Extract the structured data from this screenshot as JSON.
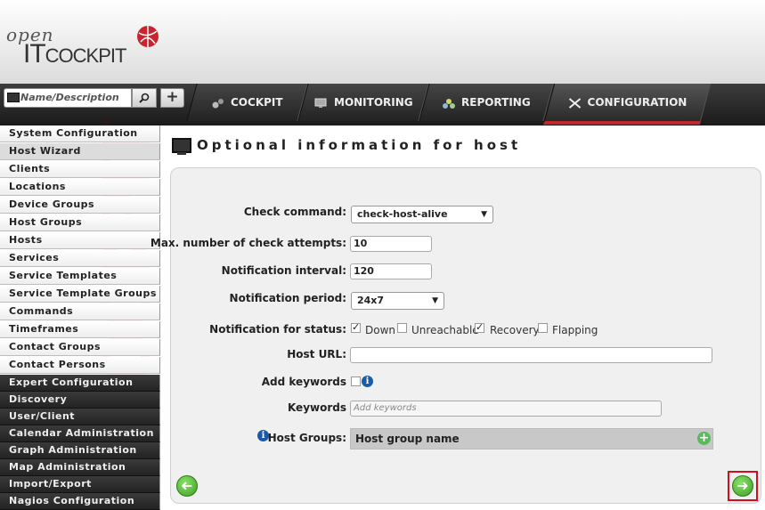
{
  "logo": {
    "open": "open",
    "it": "IT",
    "cockpit": "COCKPIT"
  },
  "search": {
    "placeholder": "Name/Description",
    "search_glyph": "⚲",
    "add_glyph": "+"
  },
  "tabs": [
    {
      "label": "COCKPIT",
      "icon": "gears-icon"
    },
    {
      "label": "MONITORING",
      "icon": "monitor-icon"
    },
    {
      "label": "REPORTING",
      "icon": "reporting-icon"
    },
    {
      "label": "CONFIGURATION",
      "icon": "tools-icon",
      "active": true
    }
  ],
  "sidebar": {
    "items": [
      {
        "label": "System Configuration",
        "style": "light"
      },
      {
        "label": "Host Wizard",
        "style": "selected"
      },
      {
        "label": "Clients",
        "style": "light"
      },
      {
        "label": "Locations",
        "style": "light"
      },
      {
        "label": "Device Groups",
        "style": "light"
      },
      {
        "label": "Host Groups",
        "style": "light"
      },
      {
        "label": "Hosts",
        "style": "light"
      },
      {
        "label": "Services",
        "style": "light"
      },
      {
        "label": "Service Templates",
        "style": "light"
      },
      {
        "label": "Service Template Groups",
        "style": "light"
      },
      {
        "label": "Commands",
        "style": "light"
      },
      {
        "label": "Timeframes",
        "style": "light"
      },
      {
        "label": "Contact Groups",
        "style": "light"
      },
      {
        "label": "Contact Persons",
        "style": "light"
      },
      {
        "label": "Expert Configuration",
        "style": "dark"
      },
      {
        "label": "Discovery",
        "style": "dark"
      },
      {
        "label": "User/Client Administration",
        "style": "dark"
      },
      {
        "label": "Calendar Administration",
        "style": "dark"
      },
      {
        "label": "Graph Administration",
        "style": "dark"
      },
      {
        "label": "Map Administration",
        "style": "dark"
      },
      {
        "label": "Import/Export",
        "style": "dark"
      },
      {
        "label": "Nagios Configuration",
        "style": "dark"
      }
    ]
  },
  "main": {
    "title": "Optional information for host",
    "form": {
      "check_command_label": "Check command:",
      "check_command_value": "check-host-alive",
      "max_attempts_label": "Max. number of check attempts:",
      "max_attempts_value": "10",
      "notification_interval_label": "Notification interval:",
      "notification_interval_value": "120",
      "notification_period_label": "Notification period:",
      "notification_period_value": "24x7",
      "notification_status_label": "Notification for status:",
      "status_options": [
        {
          "label": "Down",
          "checked": true
        },
        {
          "label": "Unreachable",
          "checked": false
        },
        {
          "label": "Recovery",
          "checked": true
        },
        {
          "label": "Flapping",
          "checked": false
        }
      ],
      "host_url_label": "Host URL:",
      "host_url_value": "",
      "add_keywords_label": "Add keywords",
      "keywords_label": "Keywords",
      "keywords_placeholder": "Add keywords",
      "host_groups_label": "Host Groups:",
      "host_groups_value": "Host group name",
      "info_glyph": "i",
      "plus_glyph": "+"
    },
    "nav": {
      "back_glyph": "➜",
      "next_glyph": "➜"
    }
  },
  "colors": {
    "accent_red": "#c1272d",
    "green": "#3b9e22",
    "info_blue": "#1a5aa6"
  }
}
